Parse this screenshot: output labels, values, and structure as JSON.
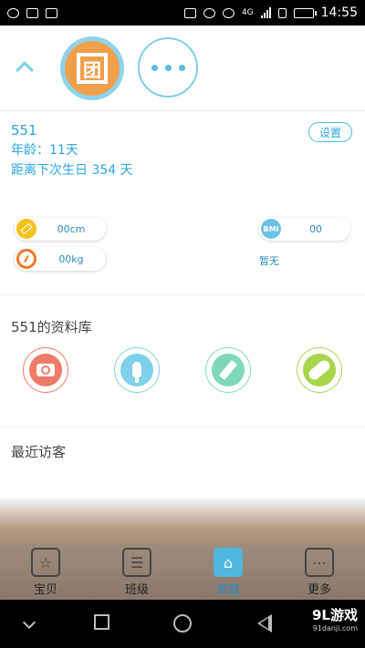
{
  "status_bar": {
    "network": "4G",
    "time": "14:55"
  },
  "profile": {
    "avatar_glyph": "团",
    "name": "551",
    "age_line": "年龄：11天",
    "birthday_line": "距离下次生日 354 天",
    "settings_label": "设置"
  },
  "metrics": {
    "height": "00cm",
    "weight": "00kg",
    "bmi_icon": "BMI",
    "bmi": "00",
    "bmi_note": "暂无"
  },
  "library": {
    "title": "551的资料库",
    "buttons": [
      {
        "icon": "camera-icon",
        "color": "#f07a6a"
      },
      {
        "icon": "microphone-icon",
        "color": "#7fd0ea"
      },
      {
        "icon": "pencil-icon",
        "color": "#7ed9b8"
      },
      {
        "icon": "pill-icon",
        "color": "#a8d64a"
      }
    ]
  },
  "visitors": {
    "title": "最近访客"
  },
  "tabs": [
    {
      "label": "宝贝",
      "icon": "star-icon",
      "active": false
    },
    {
      "label": "班级",
      "icon": "list-icon",
      "active": false
    },
    {
      "label": "家庭",
      "icon": "home-icon",
      "active": true
    },
    {
      "label": "更多",
      "icon": "more-icon",
      "active": false
    }
  ],
  "watermark": {
    "main": "9L游戏",
    "sub": "91danji.com"
  },
  "colors": {
    "accent": "#2aa7e0",
    "active_tab": "#4fb7e0"
  }
}
